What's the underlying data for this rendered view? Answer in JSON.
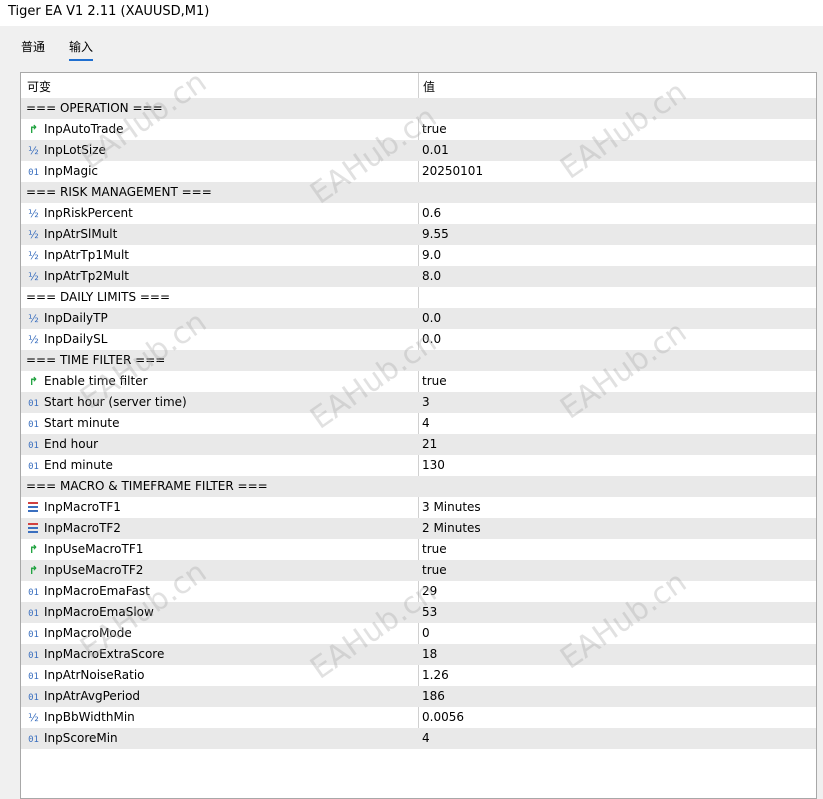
{
  "window": {
    "title": "Tiger EA V1 2.11 (XAUUSD,M1)"
  },
  "tabs": [
    {
      "label": "普通",
      "active": false
    },
    {
      "label": "输入",
      "active": true
    }
  ],
  "table": {
    "headers": {
      "variable": "可变",
      "value": "值"
    },
    "rows": [
      {
        "type": "section",
        "name": "=== OPERATION ===",
        "value": ""
      },
      {
        "type": "bool",
        "name": "InpAutoTrade",
        "value": "true"
      },
      {
        "type": "double",
        "name": "InpLotSize",
        "value": "0.01"
      },
      {
        "type": "int",
        "name": "InpMagic",
        "value": "20250101"
      },
      {
        "type": "section",
        "name": "=== RISK MANAGEMENT ===",
        "value": ""
      },
      {
        "type": "double",
        "name": "InpRiskPercent",
        "value": "0.6"
      },
      {
        "type": "double",
        "name": "InpAtrSlMult",
        "value": "9.55"
      },
      {
        "type": "double",
        "name": "InpAtrTp1Mult",
        "value": "9.0"
      },
      {
        "type": "double",
        "name": "InpAtrTp2Mult",
        "value": "8.0"
      },
      {
        "type": "section",
        "name": "=== DAILY LIMITS ===",
        "value": ""
      },
      {
        "type": "double",
        "name": "InpDailyTP",
        "value": "0.0"
      },
      {
        "type": "double",
        "name": "InpDailySL",
        "value": "0.0"
      },
      {
        "type": "section",
        "name": "=== TIME FILTER ===",
        "value": ""
      },
      {
        "type": "bool",
        "name": "Enable time filter",
        "value": "true"
      },
      {
        "type": "int",
        "name": "Start hour (server time)",
        "value": "3"
      },
      {
        "type": "int",
        "name": "Start minute",
        "value": "4"
      },
      {
        "type": "int",
        "name": "End hour",
        "value": "21"
      },
      {
        "type": "int",
        "name": "End minute",
        "value": "130"
      },
      {
        "type": "section",
        "name": "=== MACRO & TIMEFRAME FILTER ===",
        "value": ""
      },
      {
        "type": "enum",
        "name": "InpMacroTF1",
        "value": "3 Minutes"
      },
      {
        "type": "enum",
        "name": "InpMacroTF2",
        "value": "2 Minutes"
      },
      {
        "type": "bool",
        "name": "InpUseMacroTF1",
        "value": "true"
      },
      {
        "type": "bool",
        "name": "InpUseMacroTF2",
        "value": "true"
      },
      {
        "type": "int",
        "name": "InpMacroEmaFast",
        "value": "29"
      },
      {
        "type": "int",
        "name": "InpMacroEmaSlow",
        "value": "53"
      },
      {
        "type": "int",
        "name": "InpMacroMode",
        "value": "0"
      },
      {
        "type": "int",
        "name": "InpMacroExtraScore",
        "value": "18"
      },
      {
        "type": "int",
        "name": "InpAtrNoiseRatio",
        "value": "1.26"
      },
      {
        "type": "int",
        "name": "InpAtrAvgPeriod",
        "value": "186"
      },
      {
        "type": "double",
        "name": "InpBbWidthMin",
        "value": "0.0056"
      },
      {
        "type": "int",
        "name": "InpScoreMin",
        "value": "4"
      }
    ]
  },
  "icons": {
    "bool": "arrow-branch-icon",
    "double": "fraction-icon",
    "int": "integer-icon",
    "enum": "enum-list-icon"
  },
  "watermark": "EAHub.cn",
  "colors": {
    "bool_icon": "#1aa03a",
    "num_icon": "#3a6fbf",
    "tab_underline": "#1f6fd0",
    "alt_row": "#e9e9e9"
  }
}
